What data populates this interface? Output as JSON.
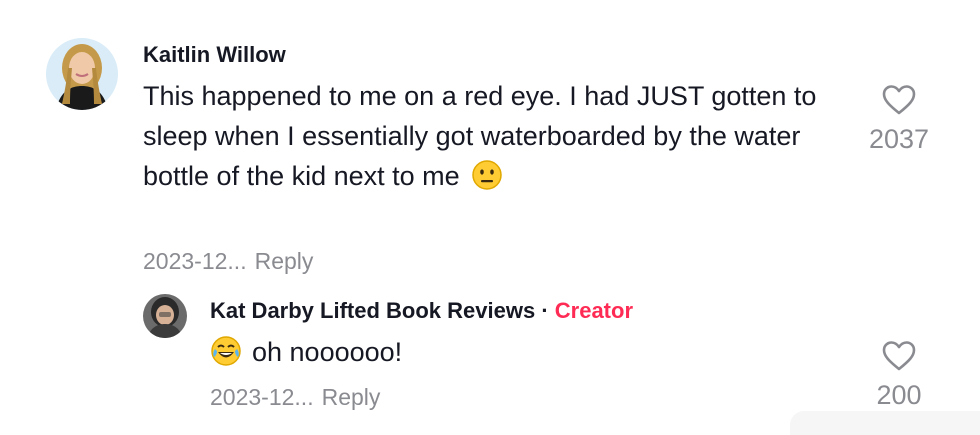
{
  "comments": [
    {
      "author": "Kaitlin Willow",
      "text_before_emoji": "This happened to me on a red eye. I had JUST gotten to sleep when I essentially got waterboarded by the water bottle of the kid next to me",
      "emoji": "neutral-face",
      "date": "2023-12...",
      "reply_label": "Reply",
      "like_count": "2037",
      "replies": [
        {
          "author": "Kat Darby Lifted Book Reviews",
          "separator": "·",
          "badge": "Creator",
          "emoji": "tears-of-joy-face",
          "text": "oh noooooo!",
          "date": "2023-12...",
          "reply_label": "Reply",
          "like_count": "200"
        }
      ]
    }
  ],
  "colors": {
    "creator_badge": "#fe2c55",
    "meta_text": "#8a8b91",
    "primary_text": "#161823"
  }
}
